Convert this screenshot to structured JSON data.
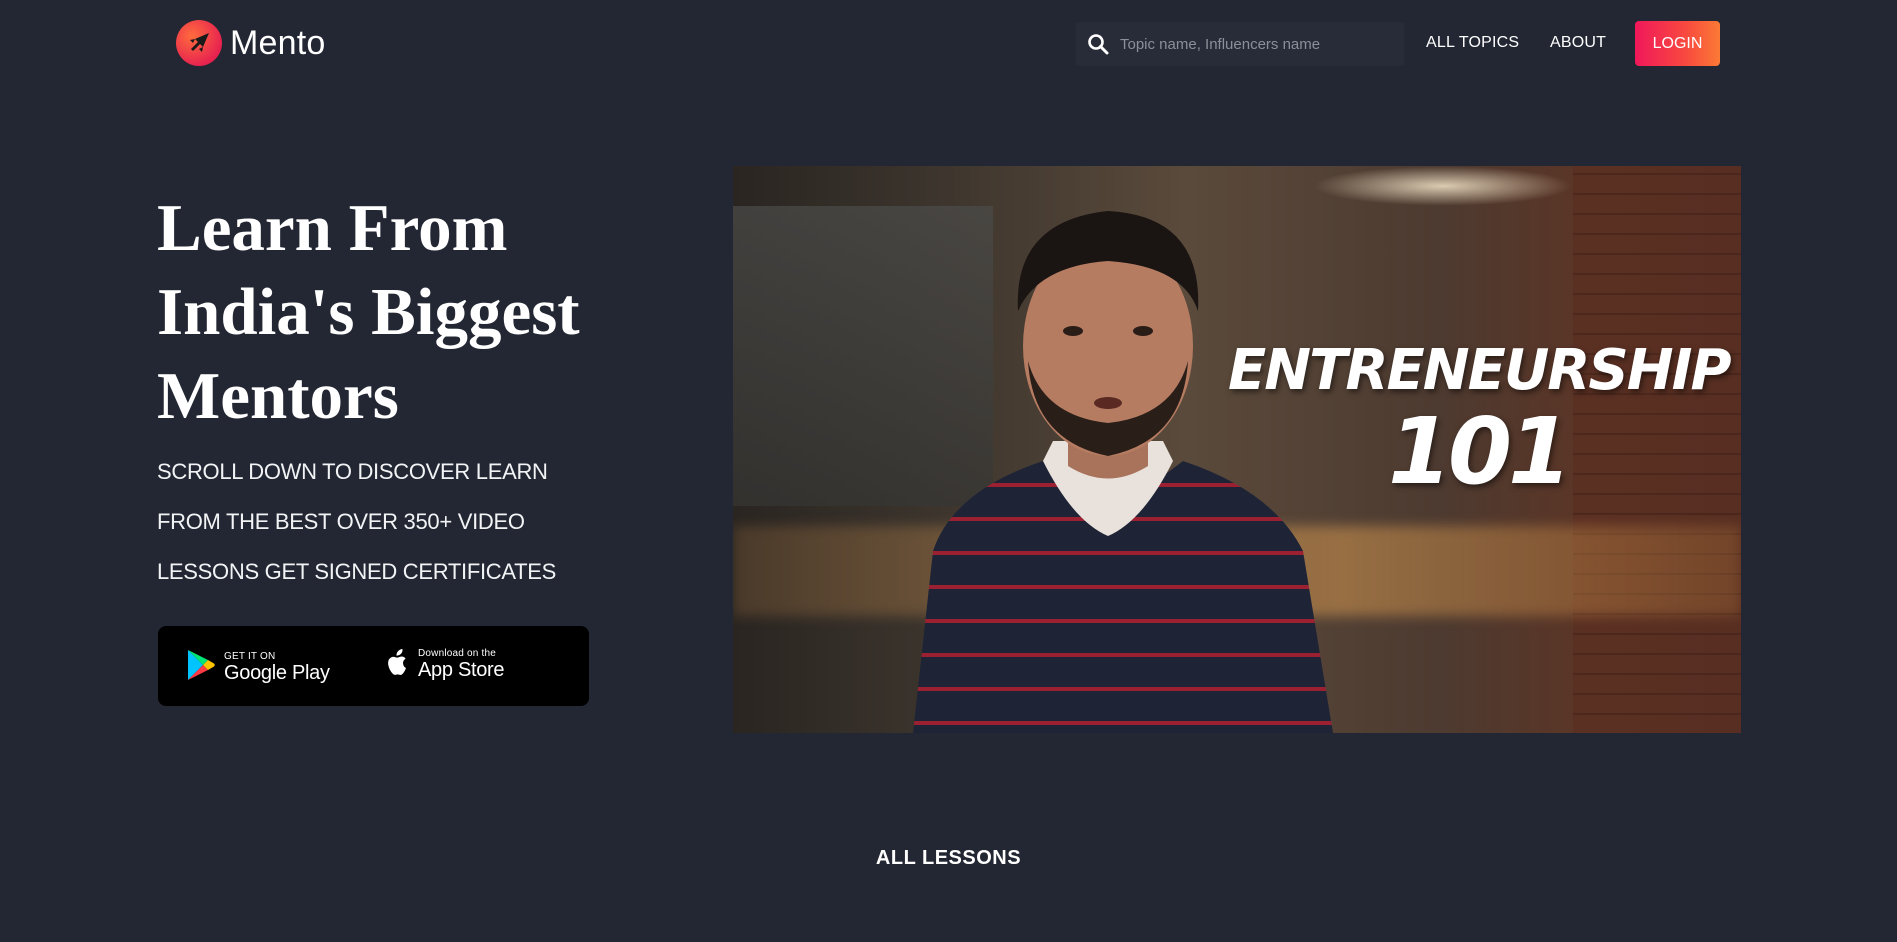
{
  "header": {
    "brand": "Mento",
    "search_placeholder": "Topic name, Influencers name",
    "search_value": "",
    "nav": {
      "all_topics": "ALL TOPICS",
      "about": "ABOUT"
    },
    "login_label": "LOGIN",
    "login_gradient": [
      "#f0185a",
      "#fb7a35"
    ]
  },
  "hero": {
    "title": "Learn From India's Biggest Mentors",
    "subtitle_lines": [
      "SCROLL DOWN TO DISCOVER LEARN",
      "FROM THE BEST OVER 350+ VIDEO",
      "LESSONS GET SIGNED CERTIFICATES"
    ],
    "stores": {
      "google": {
        "small": "GET IT ON",
        "big": "Google Play",
        "icon": "google-play-icon"
      },
      "apple": {
        "small": "Download on the",
        "big": "App Store",
        "icon": "apple-icon"
      }
    }
  },
  "video": {
    "line1": "ENTRENEURSHIP",
    "line2": "101"
  },
  "lessons": {
    "title": "ALL LESSONS"
  },
  "colors": {
    "background": "#232733",
    "search_bg": "#272c38",
    "store_box": "#000000"
  }
}
